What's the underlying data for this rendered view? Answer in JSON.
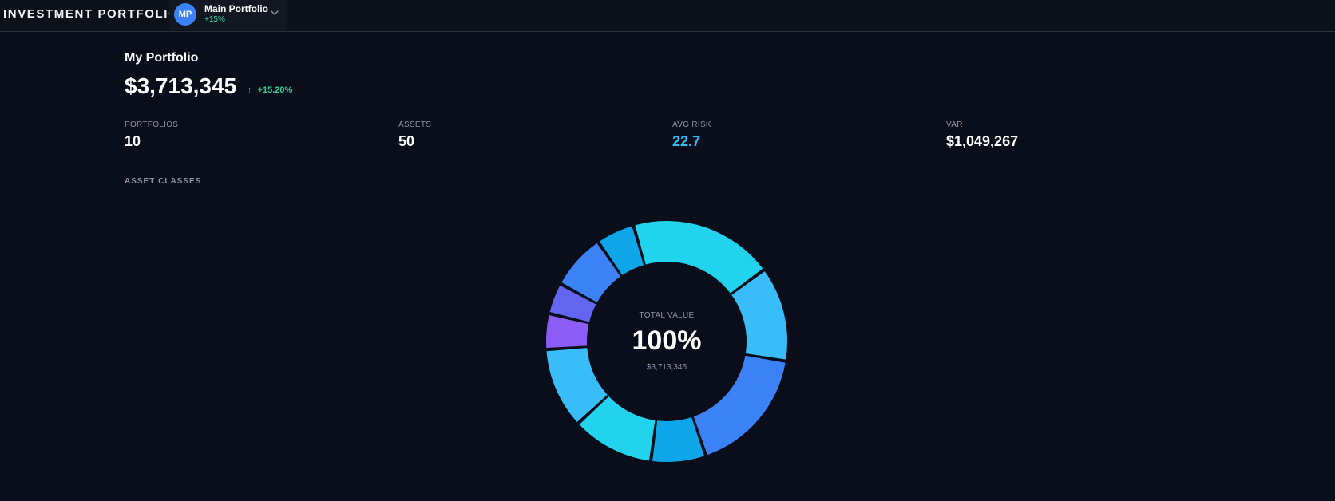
{
  "header": {
    "app_title": "INVESTMENT PORTFOLIO",
    "switcher": {
      "initials": "MP",
      "name": "Main Portfolio",
      "change": "+15%"
    }
  },
  "portfolio": {
    "title": "My Portfolio",
    "total_value": "$3,713,345",
    "change_arrow": "↑",
    "change": "+15.20%"
  },
  "stats": [
    {
      "label": "PORTFOLIOS",
      "value": "10"
    },
    {
      "label": "ASSETS",
      "value": "50"
    },
    {
      "label": "AVG RISK",
      "value": "22.7"
    },
    {
      "label": "VAR",
      "value": "$1,049,267"
    }
  ],
  "asset_classes": {
    "label": "ASSET CLASSES",
    "center_label": "TOTAL VALUE",
    "center_percent": "100%",
    "center_value": "$3,713,345"
  },
  "chart_data": {
    "type": "pie",
    "variant": "donut",
    "slices": [
      {
        "value": 20.2,
        "color": "#22d3ee"
      },
      {
        "value": 13.3,
        "color": "#38bdf8"
      },
      {
        "value": 17.9,
        "color": "#3b82f6"
      },
      {
        "value": 7.7,
        "color": "#0ea5e9"
      },
      {
        "value": 11.5,
        "color": "#22d3ee"
      },
      {
        "value": 11.3,
        "color": "#38bdf8"
      },
      {
        "value": 5.0,
        "color": "#8b5cf6"
      },
      {
        "value": 4.4,
        "color": "#6366f1"
      },
      {
        "value": 7.8,
        "color": "#3b82f6"
      },
      {
        "value": 5.4,
        "color": "#0ea5e9"
      }
    ]
  }
}
